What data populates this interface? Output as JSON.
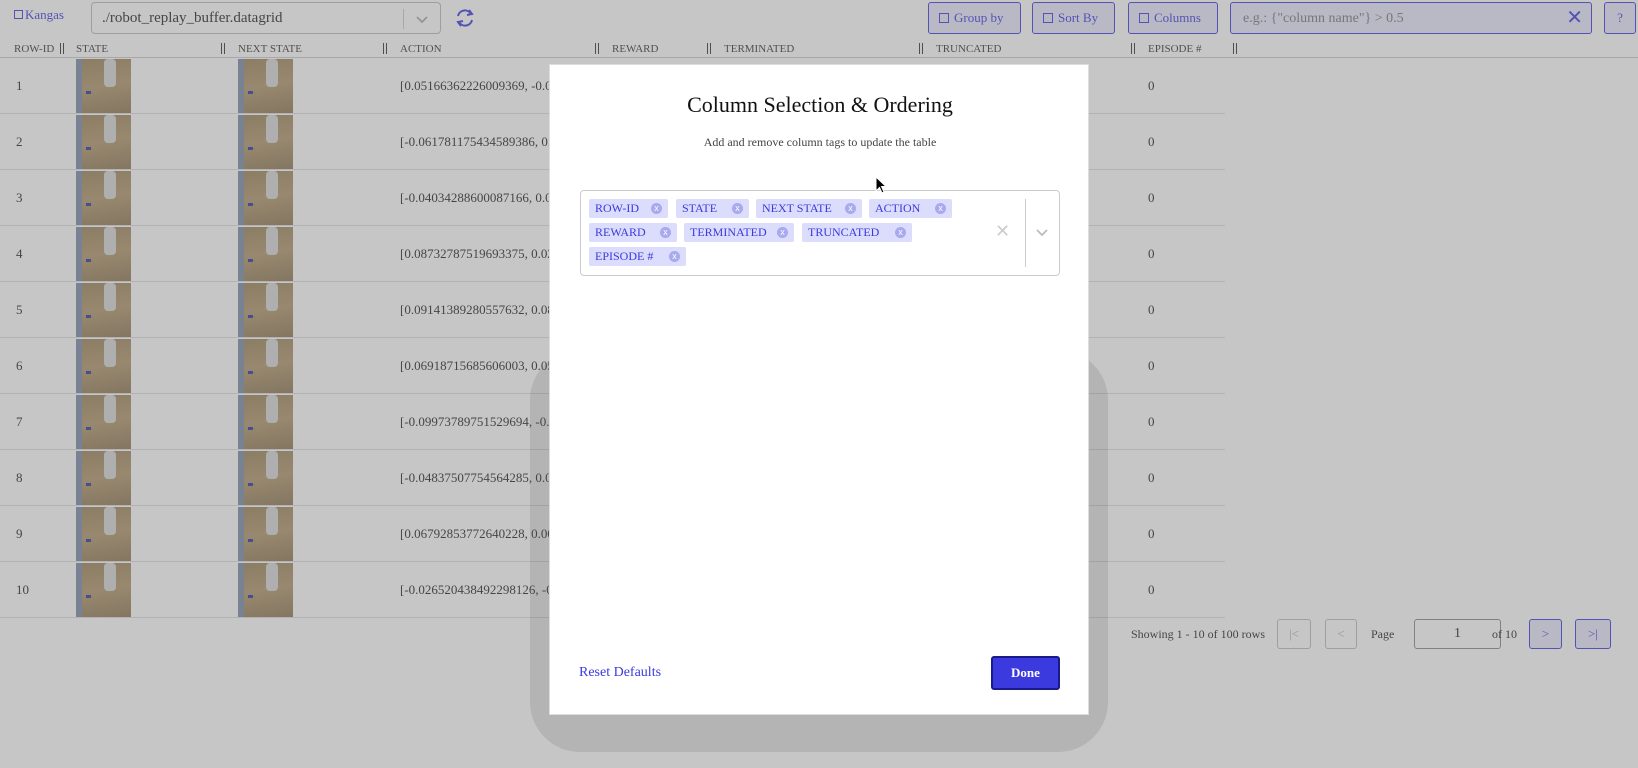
{
  "app": {
    "brand": "Kangas"
  },
  "toolbar": {
    "file": "./robot_replay_buffer.datagrid",
    "group_by": "Group by",
    "sort_by": "Sort By",
    "columns": "Columns",
    "filter_placeholder": "e.g.: {\"column name\"} > 0.5",
    "help": "?"
  },
  "table": {
    "headers": [
      "ROW-ID",
      "STATE",
      "NEXT STATE",
      "ACTION",
      "REWARD",
      "TERMINATED",
      "TRUNCATED",
      "EPISODE #"
    ],
    "rows": [
      {
        "id": "1",
        "action": "[0.05166362226009369, -0.0",
        "episode": "0"
      },
      {
        "id": "2",
        "action": "[-0.061781175434589386, 0.",
        "episode": "0"
      },
      {
        "id": "3",
        "action": "[-0.04034288600087166, 0.0",
        "episode": "0"
      },
      {
        "id": "4",
        "action": "[0.08732787519693375, 0.02",
        "episode": "0"
      },
      {
        "id": "5",
        "action": "[0.09141389280557632, 0.08",
        "episode": "0"
      },
      {
        "id": "6",
        "action": "[0.06918715685606003, 0.05",
        "episode": "0"
      },
      {
        "id": "7",
        "action": "[-0.09973789751529694, -0.",
        "episode": "0"
      },
      {
        "id": "8",
        "action": "[-0.04837507754564285, 0.0",
        "episode": "0"
      },
      {
        "id": "9",
        "action": "[0.06792853772640228, 0.00",
        "episode": "0"
      },
      {
        "id": "10",
        "action": "[-0.026520438492298126, -0",
        "episode": "0"
      }
    ]
  },
  "pager": {
    "showing": "Showing 1 - 10 of 100 rows",
    "first": "|<",
    "prev": "<",
    "page_label": "Page",
    "page_value": "1",
    "of": "of 10",
    "next": ">",
    "last": ">|"
  },
  "modal": {
    "title": "Column Selection & Ordering",
    "subtitle": "Add and remove column tags to update the table",
    "tags": [
      "ROW-ID",
      "STATE",
      "NEXT STATE",
      "ACTION",
      "REWARD",
      "TERMINATED",
      "TRUNCATED",
      "EPISODE #"
    ],
    "tag_remove": "x",
    "clear": "✕",
    "reset": "Reset Defaults",
    "done": "Done"
  },
  "colors": {
    "accent": "#3a3adf",
    "tag_bg": "#dcdcfc",
    "button_bg": "#e8e8ff"
  }
}
